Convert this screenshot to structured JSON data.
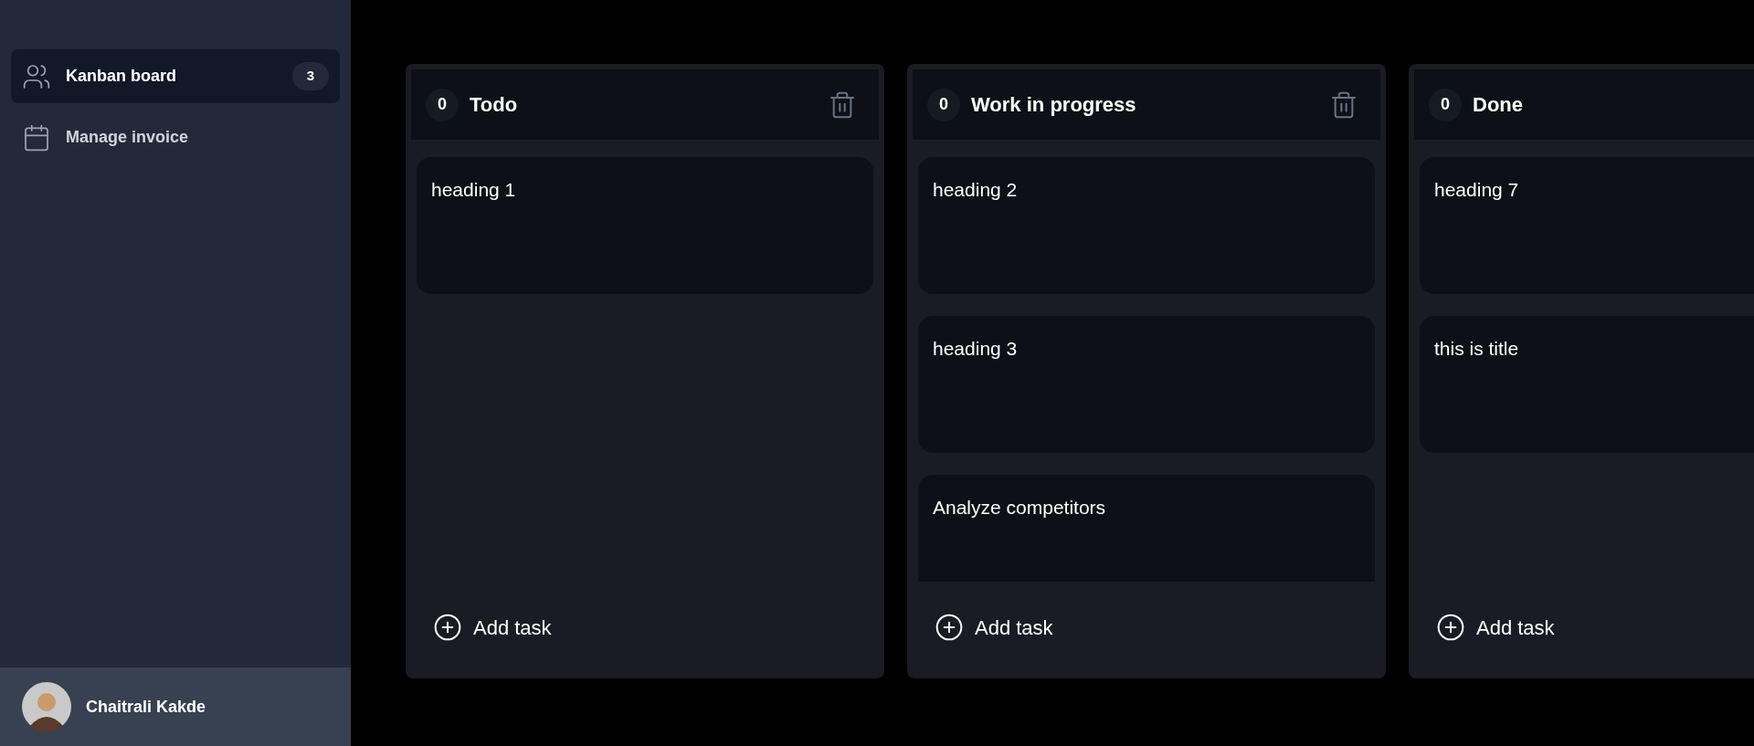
{
  "sidebar": {
    "items": [
      {
        "label": "Kanban board",
        "badge": "3",
        "selected": true
      },
      {
        "label": "Manage invoice",
        "selected": false
      }
    ],
    "user": {
      "name": "Chaitrali Kakde"
    }
  },
  "columns": [
    {
      "title": "Todo",
      "count": "0",
      "cards": [
        "heading 1"
      ],
      "add_label": "Add task"
    },
    {
      "title": "Work in progress",
      "count": "0",
      "cards": [
        "heading 2",
        "heading 3",
        "Analyze competitors"
      ],
      "add_label": "Add task"
    },
    {
      "title": "Done",
      "count": "0",
      "cards": [
        "heading 7",
        "this is title"
      ],
      "add_label": "Add task"
    }
  ]
}
